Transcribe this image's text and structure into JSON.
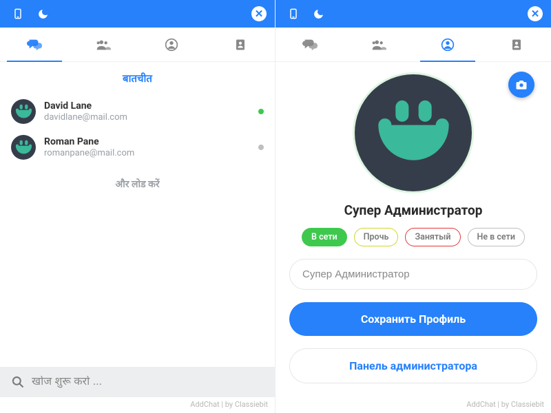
{
  "left": {
    "topbar_icons": [
      "mobile-icon",
      "moon-icon",
      "close-icon"
    ],
    "tabs": [
      "chats-tab",
      "groups-tab",
      "profile-tab",
      "contacts-tab"
    ],
    "active_tab": 0,
    "section_title": "बातचीत",
    "conversations": [
      {
        "name": "David Lane",
        "email": "davidlane@mail.com",
        "status_color": "#3ec94e"
      },
      {
        "name": "Roman Pane",
        "email": "romanpane@mail.com",
        "status_color": "#bfbfbf"
      }
    ],
    "load_more": "और लोड करें",
    "search_placeholder": "खोज शुरू करो ...",
    "footer": "AddChat | by Classiebit"
  },
  "right": {
    "topbar_icons": [
      "mobile-icon",
      "moon-icon",
      "close-icon"
    ],
    "tabs": [
      "chats-tab",
      "groups-tab",
      "profile-tab",
      "contacts-tab"
    ],
    "active_tab": 2,
    "profile_name": "Супер Администратор",
    "status_options": [
      {
        "label": "В сети",
        "border": "#3ec94e",
        "bg": "#3ec94e",
        "color": "#fff"
      },
      {
        "label": "Прочь",
        "border": "#d2d62b",
        "bg": "#fff",
        "color": "#7a7a7a"
      },
      {
        "label": "Занятый",
        "border": "#e53737",
        "bg": "#fff",
        "color": "#7a7a7a"
      },
      {
        "label": "Не в сети",
        "border": "#bdbdbd",
        "bg": "#fff",
        "color": "#7a7a7a"
      }
    ],
    "name_input_value": "Супер Администратор",
    "save_button": "Сохранить Профиль",
    "admin_button": "Панель администратора",
    "footer": "AddChat | by Classiebit"
  }
}
